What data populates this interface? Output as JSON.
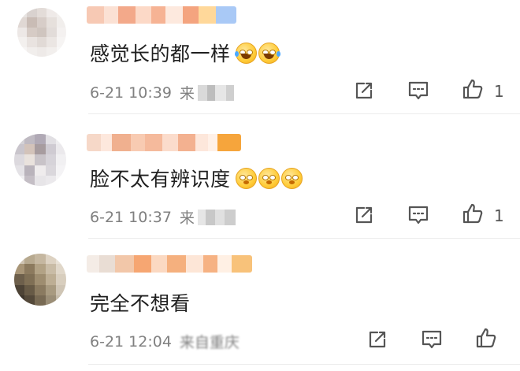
{
  "comments": [
    {
      "text": "感觉长的都一样",
      "emoji": [
        "laugh-tears-emoji",
        "laugh-tears-emoji"
      ],
      "time": "6-21 10:39",
      "source_prefix": "来",
      "source_suffix": "",
      "likes": "1",
      "liked_icon": "thumbs-up-icon"
    },
    {
      "text": "脸不太有辨识度",
      "emoji": [
        "dizzy-emoji",
        "dizzy-emoji",
        "dizzy-emoji"
      ],
      "time": "6-21 10:37",
      "source_prefix": "来",
      "source_suffix": "",
      "likes": "1",
      "liked_icon": "thumbs-up-icon"
    },
    {
      "text": "完全不想看",
      "emoji": [],
      "time": "6-21 12:04",
      "source_prefix": "来自重庆",
      "source_suffix": "",
      "likes": "",
      "liked_icon": "thumbs-up-icon"
    }
  ],
  "colors": {
    "text": "#1f1f1f",
    "meta": "#808080",
    "icon": "#555555",
    "divider": "#ececec"
  }
}
